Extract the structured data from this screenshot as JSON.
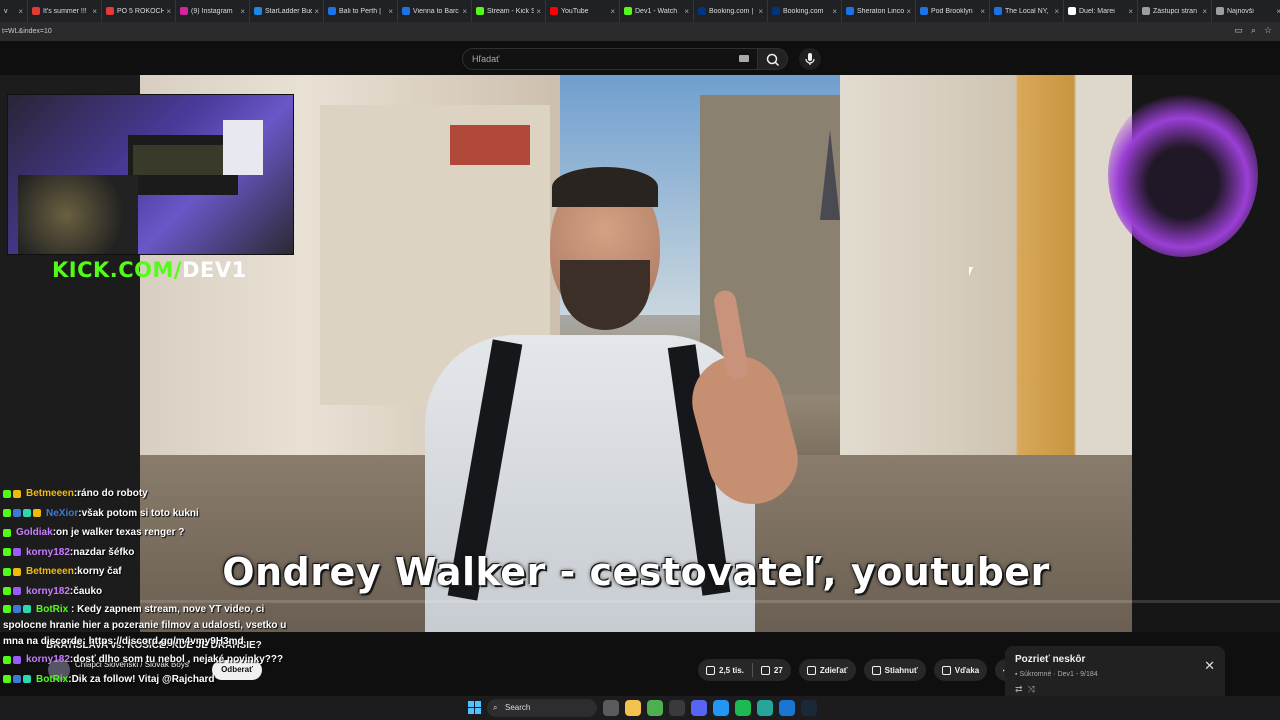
{
  "browser": {
    "tabs": [
      {
        "label": "v",
        "color": "#5f6368"
      },
      {
        "label": "It's summer !!!",
        "color": "#e53935"
      },
      {
        "label": "PO 5 ROKOCH",
        "color": "#e53935"
      },
      {
        "label": "(9) Instagram",
        "color": "#d6249f"
      },
      {
        "label": "StarLadder Bud",
        "color": "#1e88e5"
      },
      {
        "label": "Bali to Perth |",
        "color": "#1a73e8"
      },
      {
        "label": "Vienna to Barc",
        "color": "#1a73e8"
      },
      {
        "label": "Stream - Kick S",
        "color": "#53fc18"
      },
      {
        "label": "YouTube",
        "color": "#ff0000"
      },
      {
        "label": "Dev1 - Watch",
        "color": "#53fc18"
      },
      {
        "label": "Booking.com |",
        "color": "#003580"
      },
      {
        "label": "Booking.com",
        "color": "#003580"
      },
      {
        "label": "Sheraton Linco",
        "color": "#1a73e8"
      },
      {
        "label": "Pod Brooklyn",
        "color": "#1a73e8"
      },
      {
        "label": "The Local NY,",
        "color": "#1a73e8"
      },
      {
        "label": "Duel: Marei",
        "color": "#ffffff"
      },
      {
        "label": "Zástupci stran",
        "color": "#9e9e9e"
      },
      {
        "label": "Najnovši",
        "color": "#9e9e9e"
      }
    ],
    "address": "t=WL&index=10"
  },
  "youtube": {
    "search_placeholder": "Hľadať",
    "video_caption": "Ondrey Walker - cestovateľ, youtuber",
    "video_title": "BRATISLAVA vs. KOŠICE: KDE JE DRAHŠIE?",
    "channel_name": "Chlapci Slovenski / Slovak Boys",
    "subscribe_label": "Odberať",
    "likes": "2,5 tis.",
    "dislikes": "27",
    "share_label": "Zdieľať",
    "download_label": "Stiahnuť",
    "thanks_label": "Vďaka",
    "watch_later": {
      "title": "Pozrieť neskôr",
      "privacy": "Súkromné",
      "owner_position": "Dev1 - 9/184"
    }
  },
  "stream": {
    "kick_logo_green": "KICK.COM/",
    "kick_logo_white": "DEV1"
  },
  "chat": [
    {
      "user": "Betmeeen",
      "color": "#f2b90d",
      "badges": [
        "b-green",
        "b-gold"
      ],
      "text": "ráno do roboty"
    },
    {
      "user": "NeXior",
      "color": "#3a7bd5",
      "badges": [
        "b-green",
        "b-blue",
        "b-teal",
        "b-gold"
      ],
      "text": "však potom si toto kukni"
    },
    {
      "user": "Goldiak",
      "color": "#c77dff",
      "badges": [
        "b-green"
      ],
      "text": "on je walker texas renger ?"
    },
    {
      "user": "korny182",
      "color": "#c77dff",
      "badges": [
        "b-green",
        "b-purple"
      ],
      "text": "nazdar šéfko"
    },
    {
      "user": "Betmeeen",
      "color": "#f2b90d",
      "badges": [
        "b-green",
        "b-gold"
      ],
      "text": "korny čaf"
    },
    {
      "user": "korny182",
      "color": "#c77dff",
      "badges": [
        "b-green",
        "b-purple"
      ],
      "text": "čauko"
    },
    {
      "user": "BotRix",
      "color": "#53fc18",
      "badges": [
        "b-green",
        "b-blue",
        "b-teal"
      ],
      "text": "Kedy zapnem stream, nove YT video, ci spolocne hranie hier a pozeranie filmov a udalosti, vsetko u mna na discorde: https://discord.gg/m4vmy9H3md"
    },
    {
      "user": "korny182",
      "color": "#c77dff",
      "badges": [
        "b-green",
        "b-purple"
      ],
      "text": "dosť dlho som tu nebol , nejaké novinky???"
    },
    {
      "user": "BotRix",
      "color": "#53fc18",
      "badges": [
        "b-green",
        "b-blue",
        "b-teal"
      ],
      "text": "Dik za follow! Vitaj @Rajchard"
    }
  ],
  "taskbar": {
    "search_label": "Search",
    "apps": [
      {
        "name": "task-view",
        "color": "#5a5a5e"
      },
      {
        "name": "file-explorer",
        "color": "#f2c14e"
      },
      {
        "name": "chrome",
        "color": "#4caf50"
      },
      {
        "name": "app-4",
        "color": "#3a3a3e"
      },
      {
        "name": "discord",
        "color": "#5865f2"
      },
      {
        "name": "app-6",
        "color": "#2196f3"
      },
      {
        "name": "spotify",
        "color": "#1db954"
      },
      {
        "name": "app-8",
        "color": "#26a69a"
      },
      {
        "name": "app-9",
        "color": "#1976d2"
      },
      {
        "name": "steam",
        "color": "#1b2838"
      }
    ]
  }
}
